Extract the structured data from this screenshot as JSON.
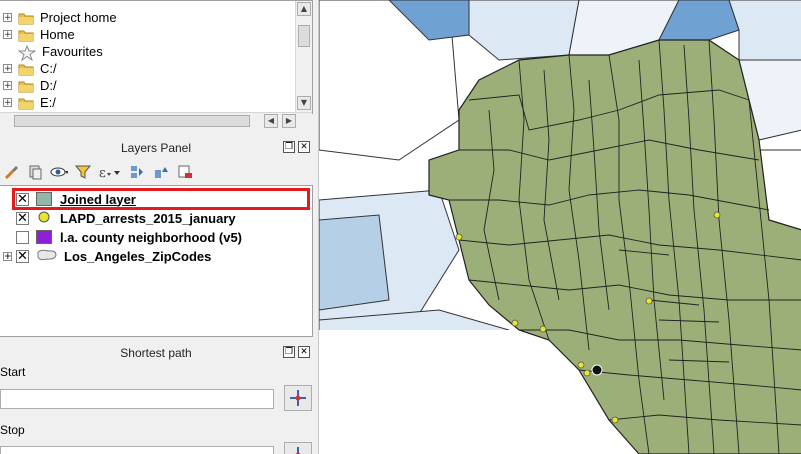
{
  "browser": {
    "items": [
      {
        "label": "Project home",
        "icon": "folder-icon",
        "expandable": true
      },
      {
        "label": "Home",
        "icon": "folder-icon",
        "expandable": true
      },
      {
        "label": "Favourites",
        "icon": "star-icon",
        "expandable": false
      },
      {
        "label": "C:/",
        "icon": "folder-icon",
        "expandable": true
      },
      {
        "label": "D:/",
        "icon": "folder-icon",
        "expandable": true
      },
      {
        "label": "E:/",
        "icon": "folder-icon",
        "expandable": true
      }
    ]
  },
  "layers_panel": {
    "title": "Layers Panel",
    "toolbar_icons": [
      "paint-brush-icon",
      "add-group-icon",
      "eye-icon",
      "filter-icon",
      "expression-filter-icon",
      "expand-all-icon",
      "collapse-all-icon",
      "remove-layer-icon"
    ],
    "layers": [
      {
        "name": "Joined layer",
        "checked": true,
        "selected": true,
        "swatch_color": "#93b7a7",
        "symbol": "polygon"
      },
      {
        "name": "LAPD_arrests_2015_january",
        "checked": true,
        "selected": false,
        "swatch_color": "#e6e62e",
        "symbol": "point"
      },
      {
        "name": "l.a. county neighborhood (v5)",
        "checked": false,
        "selected": false,
        "swatch_color": "#8e1fd6",
        "symbol": "polygon"
      },
      {
        "name": "Los_Angeles_ZipCodes",
        "checked": true,
        "selected": false,
        "swatch_color": "#e8e8e8",
        "symbol": "polygon-outline"
      }
    ]
  },
  "shortest_path": {
    "title": "Shortest path",
    "start_label": "Start",
    "stop_label": "Stop",
    "start_value": "",
    "stop_value": ""
  },
  "colors": {
    "map_green": "#9caf78",
    "map_light_blue": "#dce8f4",
    "map_mid_blue": "#b5cfe6",
    "map_dark_blue": "#6fa2d3",
    "highlight_red": "#e41a1c"
  }
}
